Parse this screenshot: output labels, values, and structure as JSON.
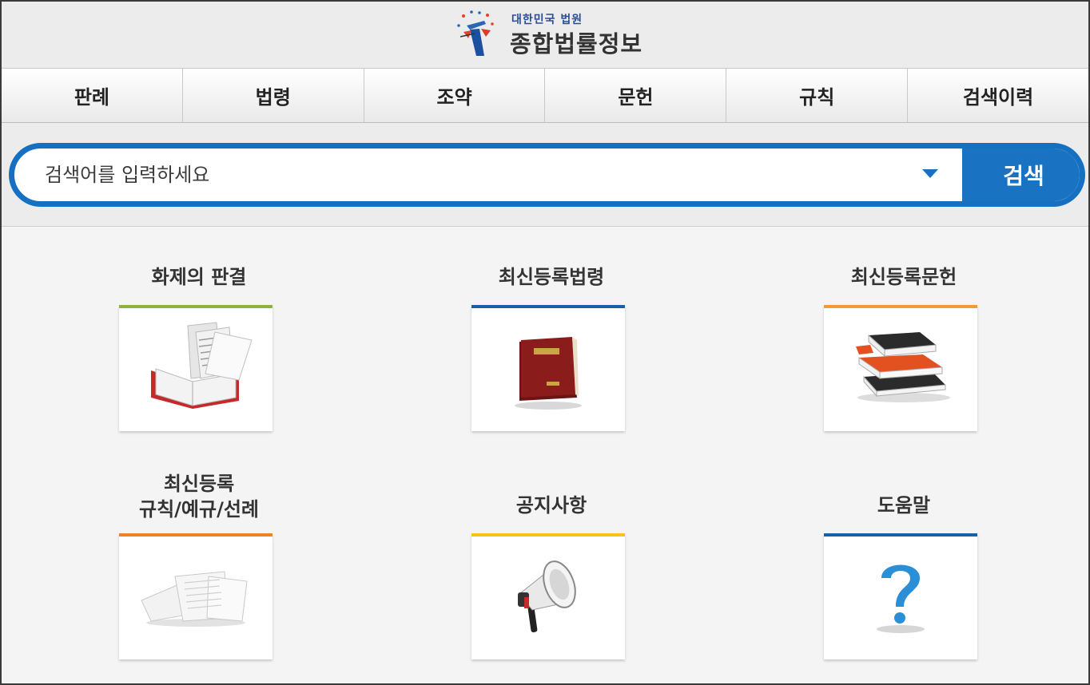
{
  "header": {
    "org": "대한민국 법원",
    "title": "종합법률정보"
  },
  "nav": {
    "tabs": [
      "판례",
      "법령",
      "조약",
      "문헌",
      "규칙",
      "검색이력"
    ]
  },
  "search": {
    "placeholder": "검색어를 입력하세요",
    "button_label": "검색"
  },
  "items": [
    {
      "title": "화제의 판결",
      "accent": "#8cb43c",
      "icon": "open-book-icon"
    },
    {
      "title": "최신등록법령",
      "accent": "#1b5fa8",
      "icon": "law-book-icon"
    },
    {
      "title": "최신등록문헌",
      "accent": "#f29a38",
      "icon": "book-stack-icon"
    },
    {
      "title_line1": "최신등록",
      "title_line2": "규칙/예규/선례",
      "accent": "#ee8226",
      "icon": "documents-icon"
    },
    {
      "title": "공지사항",
      "accent": "#f5c31c",
      "icon": "megaphone-icon"
    },
    {
      "title": "도움말",
      "accent": "#1b5fa8",
      "icon": "question-mark-icon"
    }
  ]
}
